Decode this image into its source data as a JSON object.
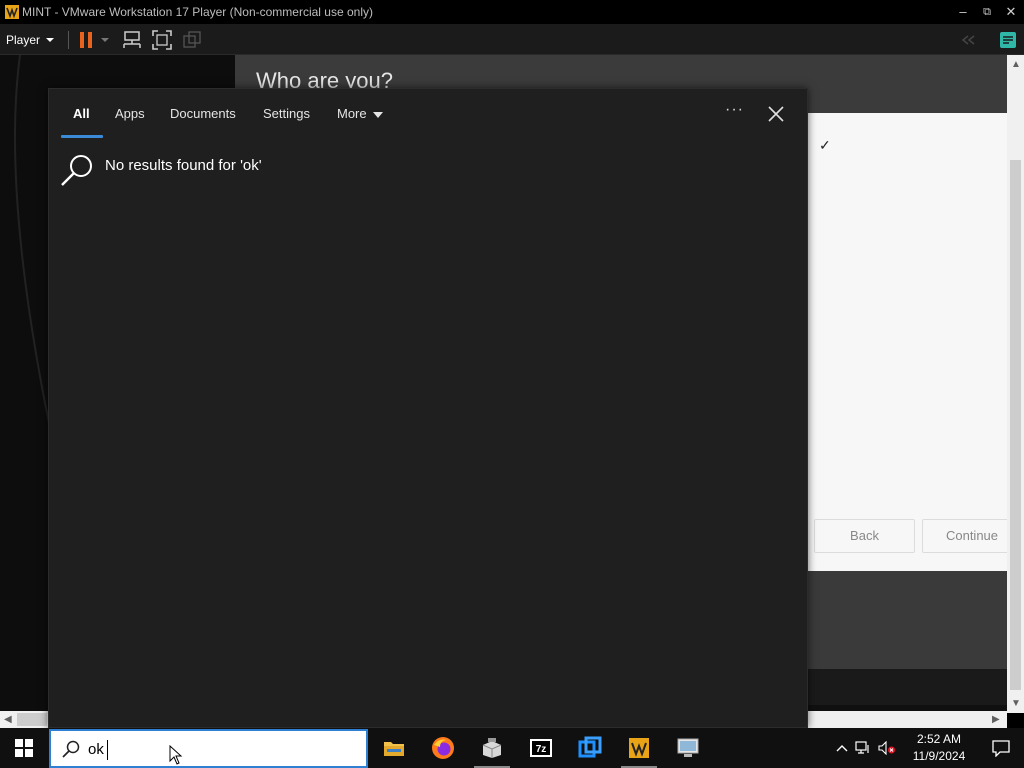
{
  "window": {
    "title": "MINT - VMware Workstation 17 Player (Non-commercial use only)",
    "minimize": "–",
    "restore": "⧉",
    "close": "✕"
  },
  "toolbar": {
    "player_label": "Player"
  },
  "installer": {
    "title": "Who are you?",
    "back_label": "Back",
    "continue_label": "Continue",
    "check": "✓"
  },
  "search_panel": {
    "tabs": [
      {
        "label": "All"
      },
      {
        "label": "Apps"
      },
      {
        "label": "Documents"
      },
      {
        "label": "Settings"
      },
      {
        "label": "More"
      }
    ],
    "dots": "···",
    "no_results_text": "No results found for 'ok'"
  },
  "taskbar": {
    "search_value": "ok",
    "clock_time": "2:52 AM",
    "clock_date": "11/9/2024",
    "apps": [
      "file-explorer",
      "firefox",
      "installer",
      "7zip",
      "virtualbox",
      "vmware",
      "control-panel"
    ]
  },
  "colors": {
    "accent": "#2f7fd3",
    "pause": "#e8641e",
    "panel_bg": "#1f1f1f"
  }
}
